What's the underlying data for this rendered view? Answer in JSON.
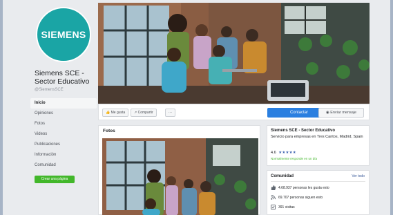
{
  "profile": {
    "logo_text": "SIEMENS",
    "page_name": "Siemens SCE - Sector Educativo",
    "handle": "@SiemensSCE"
  },
  "nav": {
    "items": [
      "Inicio",
      "Opiniones",
      "Fotos",
      "Videos",
      "Publicaciones",
      "Información",
      "Comunidad"
    ],
    "create_button": "Crear una página"
  },
  "actions": {
    "like": "Me gusta",
    "share": "Compartir",
    "more": "···",
    "contact": "Contactar",
    "message": "Enviar mensaje"
  },
  "photos": {
    "title": "Fotos"
  },
  "info": {
    "title": "Siemens SCE - Sector Educativo",
    "subtitle": "Servicio para empresas en Tres Cantos, Madrid, Spain",
    "rating": "4.6",
    "stars": "★★★★★",
    "response": "Normalmente responde en un día"
  },
  "community": {
    "title": "Comunidad",
    "see_all": "Ver todo",
    "likes": "4.68.937 personas les gusta esto",
    "follows": "69.707 personas siguen esto",
    "visits": "391 visitas"
  },
  "colors": {
    "brand_teal": "#1aa5a5",
    "primary_blue": "#2a7fe0",
    "create_green": "#42b72a",
    "background": "#e9ebee"
  }
}
